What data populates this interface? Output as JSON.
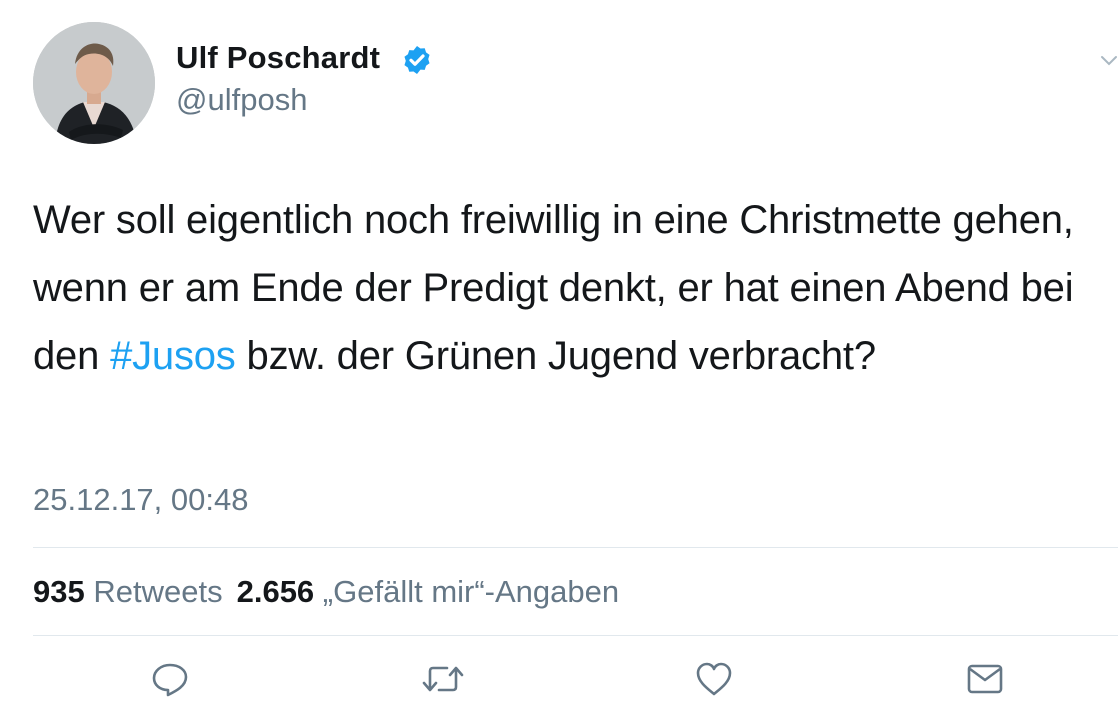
{
  "author": {
    "display_name": "Ulf Poschardt",
    "handle": "@ulfposh",
    "verified": true,
    "avatar_icon": "profile-photo"
  },
  "tweet": {
    "text_before": "Wer soll eigentlich noch freiwillig in eine Christmette gehen, wenn er am Ende der Predigt denkt, er hat einen Abend bei den ",
    "hashtag": "#Jusos",
    "text_after": " bzw. der Grünen Jugend verbracht?",
    "timestamp": "25.12.17, 00:48"
  },
  "stats": {
    "retweets_count": "935",
    "retweets_label": "Retweets",
    "likes_count": "2.656",
    "likes_label": "„Gefällt mir“-Angaben"
  },
  "actions": [
    {
      "name": "reply",
      "icon": "speech-bubble-icon"
    },
    {
      "name": "retweet",
      "icon": "retweet-arrows-icon"
    },
    {
      "name": "like",
      "icon": "heart-icon"
    },
    {
      "name": "direct-message",
      "icon": "envelope-icon"
    }
  ],
  "colors": {
    "text": "#14171a",
    "secondary": "#657786",
    "accent": "#1da1f2",
    "divider": "#e1e8ed"
  }
}
